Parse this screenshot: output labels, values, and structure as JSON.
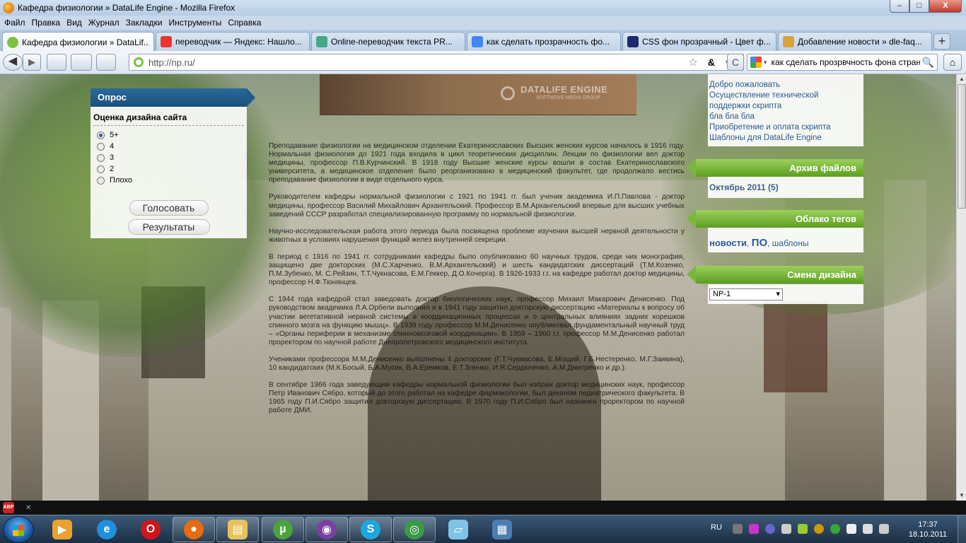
{
  "window": {
    "title": "Кафедра физиологии » DataLife Engine - Mozilla Firefox",
    "buttons": {
      "minimize": "–",
      "maximize": "□",
      "close": "X"
    }
  },
  "menu": [
    "Файл",
    "Правка",
    "Вид",
    "Журнал",
    "Закладки",
    "Инструменты",
    "Справка"
  ],
  "tabs": [
    {
      "label": "Кафедра физиологии » DataLif...",
      "icon": "dle-icon",
      "color": "#7bc142",
      "active": true
    },
    {
      "label": "переводчик — Яндекс: Нашло...",
      "icon": "yandex-icon",
      "color": "#e33"
    },
    {
      "label": "Online-переводчик текста PR...",
      "icon": "chrome-icon",
      "color": "#4a8"
    },
    {
      "label": "как сделать прозрачность фо...",
      "icon": "google-icon",
      "color": "#4285f4"
    },
    {
      "label": "CSS фон прозрачный - Цвет ф...",
      "icon": "css-icon",
      "color": "#1a2a6c"
    },
    {
      "label": "Добавление новости » dle-faq...",
      "icon": "faq-icon",
      "color": "#d9a23b"
    }
  ],
  "newtab": "+",
  "nav": {
    "url": "http://np.ru/",
    "search_query": "как сделать прозрвчность фона стран",
    "back": "◀",
    "forward": "▶",
    "reload": "C",
    "home": "⌂",
    "star": "☆",
    "amp": "&",
    "dropdown": "▾"
  },
  "banner": {
    "logo": "DATALIFE ENGINE",
    "sub": "SOFTNEWS MEDIA GROUP"
  },
  "poll": {
    "header": "Опрос",
    "question": "Оценка дизайна сайта",
    "options": [
      "5+",
      "4",
      "3",
      "2",
      "Плохо"
    ],
    "selected": 0,
    "vote_button": "Голосовать",
    "results_button": "Результаты"
  },
  "article": {
    "paragraphs": [
      "Преподавание физиологии на медицинском отделении Екатеринославских Высших женских курсов началось в 1916 году. Нормальная физиология до 1921 года входила в цикл теоретических дисциплин. Лекции по физиологии вел доктор медицины, профессор П.В.Курчинский. В 1918 году Высшие женские курсы вошли в состав Екатеринославского университета, а медицинское отделение было реорганизовано в медицинский факультет, где продолжало вестись преподавание физиологии в виде отдельного курса.",
      "Руководителем кафедры нормальной физиологии с 1921 по 1941 гг. был ученик академика И.П.Павлова - доктор медицины, профессор Василий Михайлович Архангельский. Профессор В.М.Архангельский впервые для высших учебных заведений СССР разработал специализированную программу по нормальной физиологии.",
      "Научно-исследовательская работа этого периода была посвящена проблеме изучения высшей нервной деятельности у животных в условиях нарушения функций желез внутренней секреции.",
      "В период с 1916 по 1941 гг. сотрудниками кафедры было опубликовано 60 научных трудов, среди них монография, защищено две докторских (М.С.Харченко, В.М.Архангельский) и шесть кандидатских диссертаций (Т.М.Козенко, П.М.Зубенко, М. С.Рейзин, Т.Т.Чукнасова, Е.М.Геккер, Д.О.Кочерга). В 1926-1933 г.г. на кафедре работал доктор медицины, профессор Н.Ф.Тюнянцев.",
      "С 1944 года кафедрой стал заведовать доктор биологических наук, профессор Михаил Макарович Денисенко. Под руководством академика Л.А.Орбели выполнил и в 1941 году защитил докторскую диссертацию «Материалы к вопросу об участии вегетативной нервной системы в координационных процессах и о центральных влияниях задних корешков спинного мозга на функцию мышц». В 1939 году профессор М.М.Денисенко опубликовал фундаментальный научный труд – «Органы периферии в механизме спинномозговой координации». В 1959 – 1960 г.г. профессор М.М.Денисенко работал проректором по научной работе Днепропетровского медицинского института.",
      "Учениками профессора М.М.Денисенко выполнены 4 докторские (Г.Т.Чукмасова, Е.Мощий, Г.Б.Нестеренко, М.Г.Заикина), 10 кандидатских (М.К.Босый, Б.А.Мусик, В.А.Еремков, Е.Т.Зленко, И.Я.Сердюченко, А.М.Дмитренко и др.).",
      "В сентябре 1966 года заведующим кафедры нормальной физиологии был избран доктор медицинских наук, профессор Петр Иванович Сябро, который до этого работал на кафедре фармакологии, был деканом педиатрического факультета. В 1965 году П.И.Сябро защитил докторскую диссертацию. В 1970 году П.И.Сябро был назначен проректором по научной работе ДМИ."
    ]
  },
  "sidebar": {
    "links": [
      "Добро пожаловать",
      "Осуществление технической",
      "поддержки скрипта",
      "бла бла бла",
      "Приобретение и оплата скрипта",
      "Шаблоны для DataLife Engine"
    ],
    "archive_header": "Архив файлов",
    "archive_item": "Октябрь 2011 (5)",
    "tags_header": "Облако тегов",
    "tags": [
      "новости",
      "ПО",
      "шаблоны"
    ],
    "design_header": "Смена дизайна",
    "design_value": "NP-1"
  },
  "taskbar": {
    "apps": [
      {
        "name": "media-player-icon",
        "glyph": "▶",
        "color": "#e9a12f"
      },
      {
        "name": "ie-icon",
        "glyph": "e",
        "color": "#1f8fe0"
      },
      {
        "name": "opera-icon",
        "glyph": "O",
        "color": "#d4141b"
      },
      {
        "name": "firefox-icon",
        "glyph": "●",
        "color": "#e66b12"
      },
      {
        "name": "explorer-icon",
        "glyph": "▤",
        "color": "#e7c25c"
      },
      {
        "name": "utorrent-icon",
        "glyph": "µ",
        "color": "#4aa33b"
      },
      {
        "name": "tor-icon",
        "glyph": "◉",
        "color": "#7a3fa0"
      },
      {
        "name": "skype-icon",
        "glyph": "S",
        "color": "#1ea6e0"
      },
      {
        "name": "chrome-icon",
        "glyph": "◎",
        "color": "#3a9b47"
      },
      {
        "name": "notepad-icon",
        "glyph": "▱",
        "color": "#7fc3e6"
      },
      {
        "name": "control-panel-icon",
        "glyph": "▦",
        "color": "#4b7db3"
      }
    ],
    "lang": "RU",
    "time": "17:37",
    "date": "18.10.2011",
    "tray_colors": [
      "#777",
      "#c3c",
      "#66c",
      "#ccc",
      "#9c3",
      "#c90",
      "#3a3",
      "#eee",
      "#ddd",
      "#ccc"
    ]
  },
  "addonbar": {
    "abp": "ABP",
    "close": "✕"
  }
}
